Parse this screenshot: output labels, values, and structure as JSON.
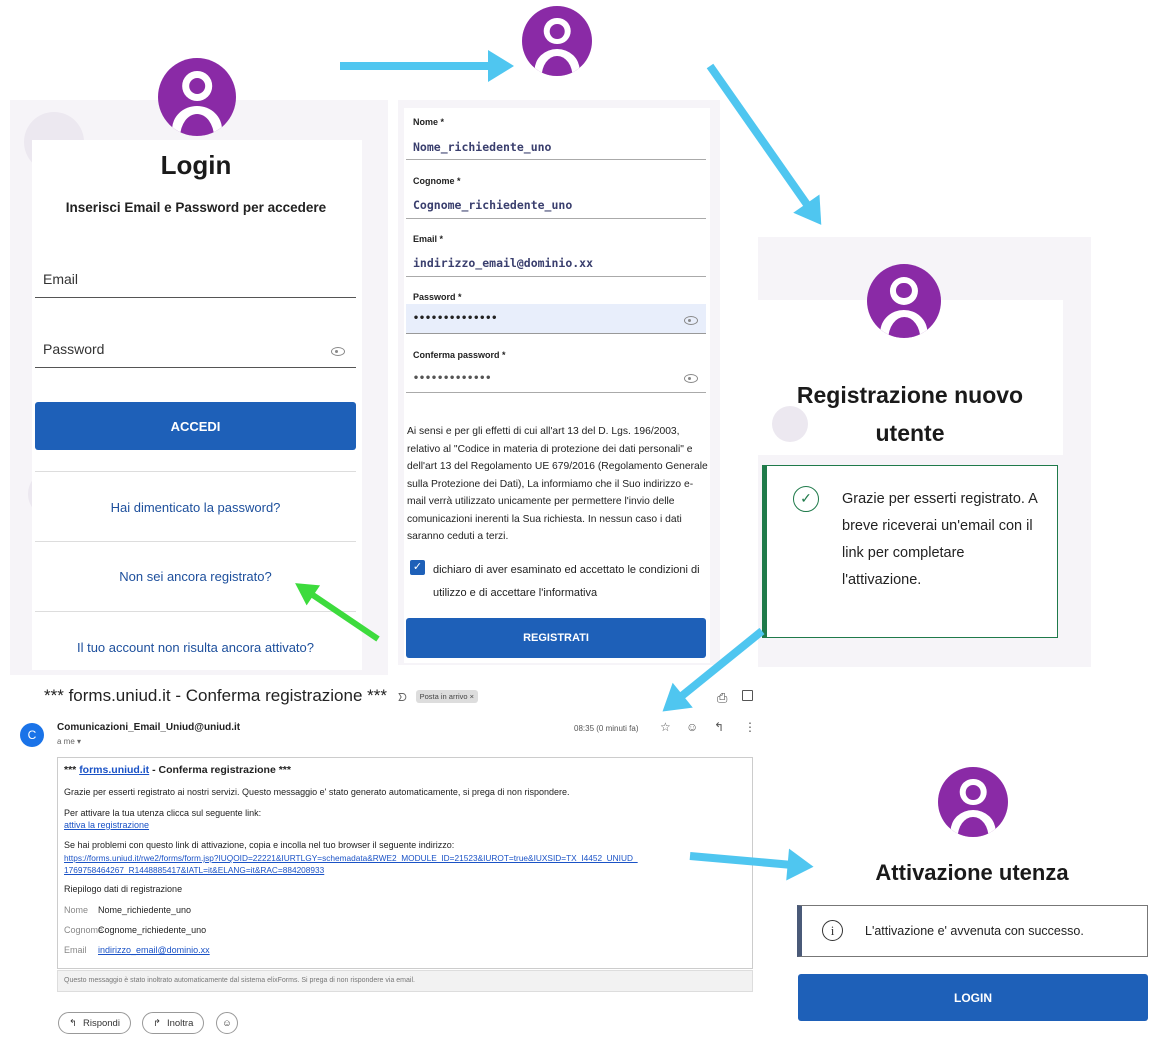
{
  "login": {
    "title": "Login",
    "subtitle": "Inserisci Email e Password per accedere",
    "email_placeholder": "Email",
    "password_placeholder": "Password",
    "submit": "ACCEDI",
    "forgot": "Hai dimenticato la password?",
    "register_link": "Non sei ancora registrato?",
    "not_activated": "Il tuo account non risulta ancora attivato?"
  },
  "register": {
    "fields": [
      {
        "label": "Nome *",
        "value": "Nome_richiedente_uno"
      },
      {
        "label": "Cognome *",
        "value": "Cognome_richiedente_uno"
      },
      {
        "label": "Email *",
        "value": "indirizzo_email@dominio.xx"
      },
      {
        "label": "Password *",
        "value": "••••••••••••••"
      },
      {
        "label": "Conferma password *",
        "value": "•••••••••••••"
      }
    ],
    "privacy": "Ai sensi e per gli effetti di cui all'art 13 del D. Lgs. 196/2003, relativo al \"Codice in materia di protezione dei dati personali\" e dell'art 13 del Regolamento UE 679/2016 (Regolamento Generale sulla Protezione dei Dati), La informiamo che il Suo indirizzo e-mail verrà utilizzato unicamente per permettere l'invio delle comunicazioni inerenti la Sua richiesta. In nessun caso i dati saranno ceduti a terzi.",
    "consent": "dichiaro di aver esaminato ed accettato le condizioni di utilizzo e di accettare l'informativa",
    "submit": "REGISTRATI"
  },
  "registered": {
    "title": "Registrazione nuovo utente",
    "message": "Grazie per esserti registrato. A breve riceverai un'email con il link per completare l'attivazione."
  },
  "email": {
    "subject": "*** forms.uniud.it - Conferma registrazione ***",
    "label": "Posta in arrivo ×",
    "avatar_letter": "C",
    "sender": "Comunicazioni_Email_Uniud@uniud.it",
    "to": "a me ▾",
    "time": "08:35 (0 minuti fa)",
    "body_title_link": "forms.uniud.it",
    "body_title_pre": "*** ",
    "body_title_post": " - Conferma registrazione ***",
    "thanks": "Grazie per esserti registrato ai nostri servizi. Questo messaggio e' stato generato automaticamente, si prega di non rispondere.",
    "activate_intro": "Per attivare la tua utenza clicca sul seguente link:",
    "activate_link": "attiva la registrazione",
    "problem": "Se hai problemi con questo link di attivazione, copia e incolla nel tuo browser il seguente indirizzo:",
    "url1": "https://forms.uniud.it/rwe2/forms/form.jsp?IUQOID=22221&IURTLGY=schemadata&RWE2_MODULE_ID=21523&IUROT=true&IUXSID=TX_I4452_UNIUD_",
    "url2": "1769758464267_R1448885417&IATL=it&ELANG=it&RAC=884208933",
    "summary": "Riepilogo dati di registrazione",
    "rows": [
      {
        "k": "Nome",
        "v": "Nome_richiedente_uno"
      },
      {
        "k": "Cognome",
        "v": "Cognome_richiedente_uno"
      },
      {
        "k": "Email",
        "v": "indirizzo_email@dominio.xx"
      }
    ],
    "footer": "Questo messaggio è stato inoltrato automaticamente dal sistema elixForms. Si prega di non rispondere via email.",
    "reply": "Rispondi",
    "forward": "Inoltra"
  },
  "activation": {
    "title": "Attivazione utenza",
    "message": "L'attivazione e' avvenuta con successo.",
    "submit": "LOGIN"
  },
  "colors": {
    "accent": "#1e60b8",
    "avatar": "#8a2aa6",
    "arrow": "#4fc6f0",
    "success": "#1f7a4a"
  }
}
